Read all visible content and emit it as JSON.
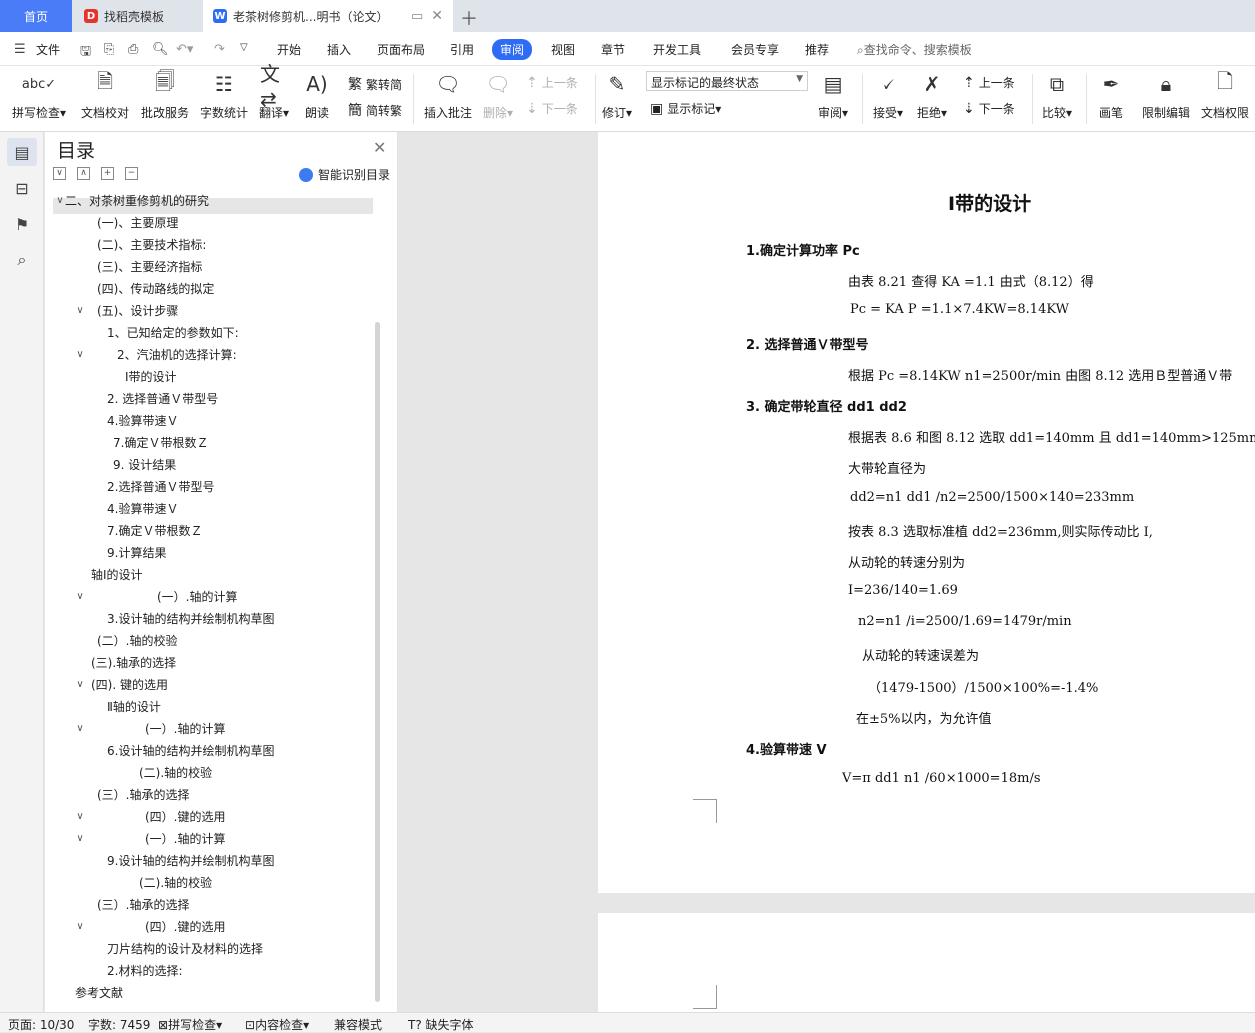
{
  "tabs": {
    "home": "首页",
    "template": "找稻壳模板",
    "doc": "老茶树修剪机...明书（论文）"
  },
  "menu": {
    "file": "文件",
    "items": [
      "开始",
      "插入",
      "页面布局",
      "引用",
      "审阅",
      "视图",
      "章节",
      "开发工具",
      "会员专享",
      "推荐"
    ],
    "active": "审阅",
    "search": "查找命令、搜索模板"
  },
  "ribbon": {
    "spell": "拼写检查",
    "proof": "文档校对",
    "batch": "批改服务",
    "wordcount": "字数统计",
    "translate": "翻译",
    "read": "朗读",
    "to_trad": "繁转简",
    "to_simp": "简转繁",
    "insert_comment": "插入批注",
    "delete": "删除",
    "prev": "上一条",
    "next": "下一条",
    "track": "修订",
    "mark_state": "显示标记的最终状态",
    "show_marks": "显示标记",
    "review": "审阅",
    "accept": "接受",
    "reject": "拒绝",
    "prev2": "上一条",
    "next2": "下一条",
    "compare": "比较",
    "pen": "画笔",
    "restrict": "限制编辑",
    "permission": "文档权限"
  },
  "toc": {
    "title": "目录",
    "smart": "智能识别目录",
    "items": [
      "二、对茶树重修剪机的研究",
      "(一)、主要原理",
      "(二)、主要技术指标:",
      "(三)、主要经济指标",
      "(四)、传动路线的拟定",
      "(五)、设计步骤",
      "1、已知给定的参数如下:",
      "2、汽油机的选择计算:",
      "Ⅰ带的设计",
      "2. 选择普通Ｖ带型号",
      "4.验算带速Ｖ",
      "7.确定Ｖ带根数Ｚ",
      "9.  设计结果",
      "2.选择普通Ｖ带型号",
      "4.验算带速Ｖ",
      "7.确定Ｖ带根数Ｚ",
      "9.计算结果",
      "轴Ⅰ的设计",
      "(一）.轴的计算",
      "3.设计轴的结构并绘制机构草图",
      "(二）.轴的校验",
      "(三).轴承的选择",
      "(四). 键的选用",
      "Ⅱ轴的设计",
      "(一）.轴的计算",
      "6.设计轴的结构并绘制机构草图",
      "(二).轴的校验",
      "(三）.轴承的选择",
      "(四）.键的选用",
      "(一）.轴的计算",
      "9.设计轴的结构并绘制机构草图",
      "(二).轴的校验",
      "(三）.轴承的选择",
      "(四）.键的选用",
      "刀片结构的设计及材料的选择",
      "2.材料的选择:",
      "参考文献"
    ]
  },
  "doc": {
    "title": "Ⅰ带的设计",
    "lines": [
      "1.确定计算功率 Pc",
      "由表 8.21 查得 KA =1.1    由式（8.12）得",
      "Pc = KA P =1.1×7.4KW=8.14KW",
      "2.  选择普通Ｖ带型号",
      "根据 Pc =8.14KW       n1=2500r/min    由图 8.12 选用Ｂ型普通Ｖ带",
      "3.  确定带轮直径   dd1    dd2",
      "根据表 8.6 和图 8.12 选取 dd1=140mm   且 dd1=140mm>125mm",
      "大带轮直径为",
      "dd2=n1 dd1 /n2=2500/1500×140=233mm",
      "按表 8.3 选取标准植 dd2=236mm,则实际传动比 I,",
      "从动轮的转速分别为",
      "I=236/140=1.69",
      "n2=n1 /i=2500/1.69=1479r/min",
      "从动轮的转速误差为",
      "（1479-1500）/1500×100%=-1.4%",
      "在±5%以内，为允许值",
      "4.验算带速 V",
      "V=π dd1 n1 /60×1000=18m/s"
    ]
  },
  "status": {
    "page": "页面: 10/30",
    "words": "字数: 7459",
    "spell": "拼写检查",
    "content": "内容检查",
    "compat": "兼容模式",
    "font": "缺失字体"
  }
}
